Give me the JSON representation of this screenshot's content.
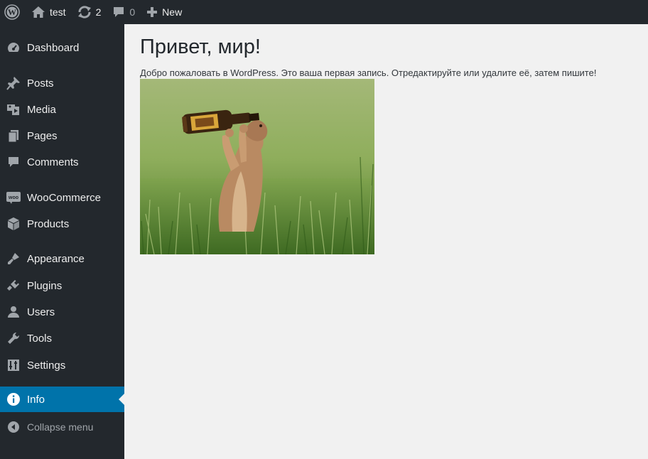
{
  "adminbar": {
    "site_name": "test",
    "updates_count": "2",
    "comments_count": "0",
    "new_label": "New"
  },
  "sidebar": {
    "items": [
      {
        "label": "Dashboard",
        "icon": "dashboard-icon"
      },
      {
        "label": "Posts",
        "icon": "pushpin-icon"
      },
      {
        "label": "Media",
        "icon": "media-icon"
      },
      {
        "label": "Pages",
        "icon": "pages-icon"
      },
      {
        "label": "Comments",
        "icon": "comment-icon"
      },
      {
        "label": "WooCommerce",
        "icon": "woocommerce-icon"
      },
      {
        "label": "Products",
        "icon": "box-icon"
      },
      {
        "label": "Appearance",
        "icon": "paintbrush-icon"
      },
      {
        "label": "Plugins",
        "icon": "plug-icon"
      },
      {
        "label": "Users",
        "icon": "user-icon"
      },
      {
        "label": "Tools",
        "icon": "wrench-icon"
      },
      {
        "label": "Settings",
        "icon": "settings-sliders-icon"
      },
      {
        "label": "Info",
        "icon": "info-icon",
        "active": true
      },
      {
        "label": "Collapse menu",
        "icon": "collapse-arrow-icon"
      }
    ],
    "active_color": "#0073aa"
  },
  "post": {
    "title": "Привет, мир!",
    "text": "Добро пожаловать в WordPress. Это ваша первая запись. Отредактируйте или удалите её, затем пишите!",
    "image": "photo of a prairie dog standing in grass drinking from a beer bottle"
  },
  "colors": {
    "adminbar_bg": "#23282d",
    "content_bg": "#f1f1f1"
  }
}
